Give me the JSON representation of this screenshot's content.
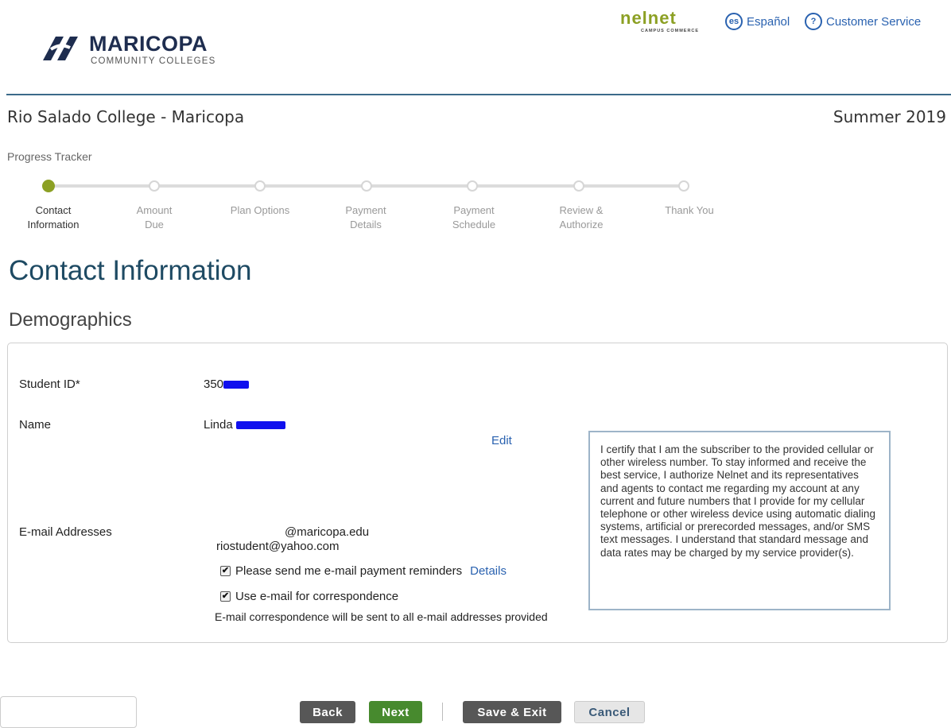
{
  "header": {
    "logo_name": "MARICOPA",
    "logo_sub": "COMMUNITY COLLEGES",
    "partner_logo": "nelnet",
    "partner_sub": "CAMPUS COMMERCE",
    "language_icon_text": "es",
    "language_label": "Español",
    "help_icon_text": "?",
    "help_label": "Customer Service",
    "colors": {
      "brand_navy": "#1e2d4f",
      "nelnet_green": "#8ca024",
      "link_blue": "#2a62b0"
    }
  },
  "context": {
    "college": "Rio Salado College - Maricopa",
    "term": "Summer 2019"
  },
  "progress": {
    "label": "Progress Tracker",
    "current_step": 1,
    "steps": [
      {
        "line1": "Contact",
        "line2": "Information"
      },
      {
        "line1": "Amount",
        "line2": "Due"
      },
      {
        "line1": "Plan Options",
        "line2": ""
      },
      {
        "line1": "Payment",
        "line2": "Details"
      },
      {
        "line1": "Payment",
        "line2": "Schedule"
      },
      {
        "line1": "Review &",
        "line2": "Authorize"
      },
      {
        "line1": "Thank You",
        "line2": ""
      }
    ]
  },
  "page": {
    "title": "Contact Information",
    "section": "Demographics"
  },
  "demographics": {
    "student_id_label": "Student ID*",
    "student_id_value": "350",
    "name_label": "Name",
    "name_value": "Linda",
    "edit_label": "Edit",
    "email_label": "E-mail Addresses",
    "email_1": "@maricopa.edu",
    "email_2": "riostudent@yahoo.com",
    "reminders_label": "Please send me e-mail payment reminders",
    "reminders_checked": true,
    "details_label": "Details",
    "correspondence_label": "Use e-mail for correspondence",
    "correspondence_checked": true,
    "correspondence_note": "E-mail correspondence will be sent to all e-mail addresses provided"
  },
  "disclaimer": "I certify that I am the subscriber to the provided cellular or other wireless number. To stay informed and receive the best service, I authorize Nelnet and its representatives and agents to contact me regarding my account at any current and future numbers that I provide for my cellular telephone or other wireless device using automatic dialing systems, artificial or prerecorded messages, and/or SMS text messages. I understand that standard message and data rates may be charged by my service provider(s).",
  "footer": {
    "back": "Back",
    "next": "Next",
    "save_exit": "Save & Exit",
    "cancel": "Cancel"
  }
}
